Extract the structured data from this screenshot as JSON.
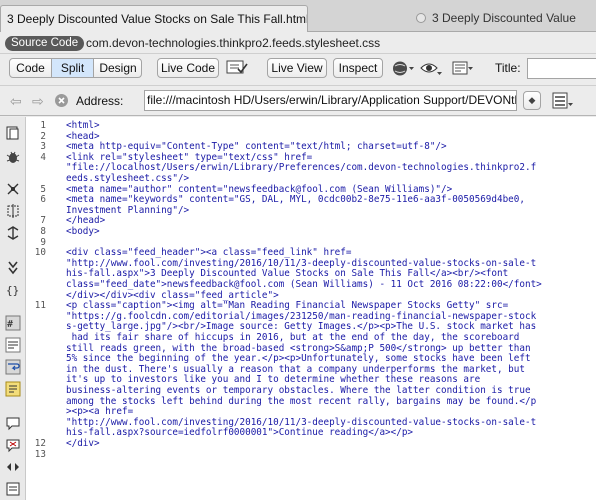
{
  "tabs": {
    "active": "3 Deeply Discounted Value Stocks on Sale This Fall.html",
    "inactive": "3 Deeply Discounted Value"
  },
  "related": {
    "source_label": "Source Code",
    "file": "com.devon-technologies.thinkpro2.feeds.stylesheet.css"
  },
  "toolbar": {
    "code": "Code",
    "split": "Split",
    "design": "Design",
    "live_code": "Live Code",
    "live_view": "Live View",
    "inspect": "Inspect",
    "title_label": "Title:"
  },
  "address": {
    "label": "Address:",
    "value": "file:///macintosh HD/Users/erwin/Library/Application Support/DEVONthink"
  },
  "code": {
    "lines": [
      {
        "n": "1",
        "t": "<html>"
      },
      {
        "n": "2",
        "t": "<head>"
      },
      {
        "n": "3",
        "t": "<meta http-equiv=\"Content-Type\" content=\"text/html; charset=utf-8\"/>"
      },
      {
        "n": "4",
        "t": "<link rel=\"stylesheet\" type=\"text/css\" href="
      },
      {
        "n": "",
        "t": "\"file://localhost/Users/erwin/Library/Preferences/com.devon-technologies.thinkpro2.f"
      },
      {
        "n": "",
        "t": "eeds.stylesheet.css\"/>"
      },
      {
        "n": "5",
        "t": "<meta name=\"author\" content=\"newsfeedback@fool.com (Sean Williams)\"/>"
      },
      {
        "n": "6",
        "t": "<meta name=\"keywords\" content=\"GS, DAL, MYL, 0cdc00b2-8e75-11e6-aa3f-0050569d4be0,"
      },
      {
        "n": "",
        "t": "Investment Planning\"/>"
      },
      {
        "n": "7",
        "t": "</head>"
      },
      {
        "n": "8",
        "t": "<body>"
      },
      {
        "n": "9",
        "t": ""
      },
      {
        "n": "10",
        "t": "<div class=\"feed_header\"><a class=\"feed_link\" href="
      },
      {
        "n": "",
        "t": "\"http://www.fool.com/investing/2016/10/11/3-deeply-discounted-value-stocks-on-sale-t"
      },
      {
        "n": "",
        "t": "his-fall.aspx\">3 Deeply Discounted Value Stocks on Sale This Fall</a><br/><font"
      },
      {
        "n": "",
        "t": "class=\"feed_date\">newsfeedback@fool.com (Sean Williams) - 11 Oct 2016 08:22:00</font>"
      },
      {
        "n": "",
        "t": "</div></div><div class=\"feed_article\">"
      },
      {
        "n": "11",
        "t": "<p class=\"caption\"><img alt=\"Man Reading Financial Newspaper Stocks Getty\" src="
      },
      {
        "n": "",
        "t": "\"https://g.foolcdn.com/editorial/images/231250/man-reading-financial-newspaper-stock"
      },
      {
        "n": "",
        "t": "s-getty_large.jpg\"/><br/>Image source: Getty Images.</p><p>The U.S. stock market has"
      },
      {
        "n": "",
        "t": " had its fair share of hiccups in 2016, but at the end of the day, the scoreboard"
      },
      {
        "n": "",
        "t": "still reads green, with the broad-based <strong>S&amp;P 500</strong> up better than"
      },
      {
        "n": "",
        "t": "5% since the beginning of the year.</p><p>Unfortunately, some stocks have been left"
      },
      {
        "n": "",
        "t": "in the dust. There's usually a reason that a company underperforms the market, but"
      },
      {
        "n": "",
        "t": "it's up to investors like you and I to determine whether these reasons are"
      },
      {
        "n": "",
        "t": "business-altering events or temporary obstacles. Where the latter condition is true"
      },
      {
        "n": "",
        "t": "among the stocks left behind during the most recent rally, bargains may be found.</p"
      },
      {
        "n": "",
        "t": "><p><a href="
      },
      {
        "n": "",
        "t": "\"http://www.fool.com/investing/2016/10/11/3-deeply-discounted-value-stocks-on-sale-t"
      },
      {
        "n": "",
        "t": "his-fall.aspx?source=iedfolrf0000001\">Continue reading</a></p>"
      },
      {
        "n": "12",
        "t": "</div>"
      },
      {
        "n": "13",
        "t": ""
      }
    ]
  }
}
